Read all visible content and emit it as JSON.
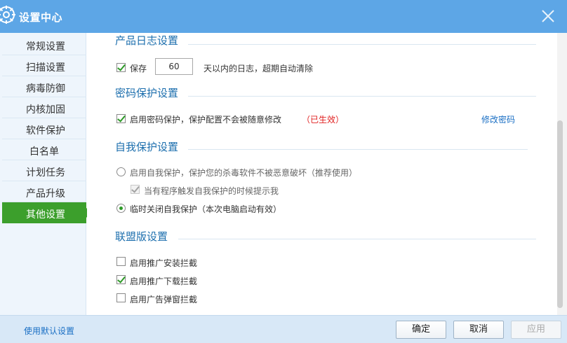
{
  "window": {
    "title": "设置中心"
  },
  "sidebar": {
    "items": [
      {
        "label": "常规设置"
      },
      {
        "label": "扫描设置"
      },
      {
        "label": "病毒防御"
      },
      {
        "label": "内核加固"
      },
      {
        "label": "软件保护"
      },
      {
        "label": "白名单"
      },
      {
        "label": "计划任务"
      },
      {
        "label": "产品升级"
      },
      {
        "label": "其他设置"
      }
    ],
    "active_index": 8
  },
  "log": {
    "title": "产品日志设置",
    "keep_label": "保存",
    "keep_checked": true,
    "days_value": "60",
    "suffix": "天以内的日志，超期自动清除"
  },
  "password": {
    "title": "密码保护设置",
    "enable_label": "启用密码保护，保护配置不会被随意修改",
    "enable_checked": true,
    "status": "（已生效）",
    "change_link": "修改密码"
  },
  "self_protect": {
    "title": "自我保护设置",
    "enable_label": "启用自我保护，保护您的杀毒软件不被恶意破坏（推荐使用）",
    "enable_checked": false,
    "notify_label": "当有程序触发自我保护的时候提示我",
    "notify_checked": true,
    "disable_label": "临时关闭自我保护（本次电脑启动有效）",
    "disable_checked": true
  },
  "alliance": {
    "title": "联盟版设置",
    "options": [
      {
        "label": "启用推广安装拦截",
        "checked": false
      },
      {
        "label": "启用推广下载拦截",
        "checked": true
      },
      {
        "label": "启用广告弹窗拦截",
        "checked": false
      }
    ]
  },
  "footer": {
    "default_link": "使用默认设置",
    "ok": "确定",
    "cancel": "取消",
    "apply": "应用"
  },
  "colors": {
    "titlebar": "#5da6e6",
    "active_nav": "#3c9f2c",
    "section_title": "#1d6fae",
    "link": "#1a6fc4",
    "status_red": "#e02020"
  }
}
